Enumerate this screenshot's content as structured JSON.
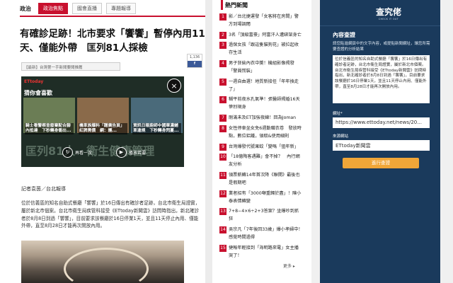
{
  "nav": {
    "category": "政治",
    "tabs": [
      "政治焦點",
      "國會直播",
      "專題報導"
    ]
  },
  "article": {
    "headline": "有確診足跡！北市要求「饗饗」暫停內用11天、僅能外帶　匡列81人採檢",
    "tag": "【最新】台灣第一手新聞要聞推薦",
    "share_count": "1,136",
    "reporter": "記者袁茵／台北報導",
    "body": "位於信義區的知名自助式餐廳「饗饗」於16日傳出有確診者足跡，台北市衛生局證實，屬於新北市個案。台北市衛生局疾管科接受《ETtoday新聞雲》訪問時指出，新北確診者於8月8日到過「饗饗」，目前要求該餐廳於16日停業1天，並且11天停止內用、僅能外帶，直至8月28日才能再次開放內用。"
  },
  "video": {
    "logo": "ETtoday",
    "recommend_label": "猜你會喜歡",
    "bg_text": "匡列81人　衛生健康管理",
    "thumbs": [
      {
        "caption": "騎士看警察查廢棄配合腳內抵達　下秒轉身衝出...",
        "color": "#6b7d55"
      },
      {
        "caption": "機車族爆料「蹭廣告頁」紅牌黑價　網：護...",
        "color": "#8a6a4a"
      },
      {
        "caption": "資訊日報廚師中國華濃鋪車違規　下秒轉身閃蔓...",
        "color": "#4a6a7a"
      }
    ],
    "replay_label": "再看一次",
    "next_label": "播放若要",
    "close_label": "×"
  },
  "hot": {
    "title": "熱門新聞",
    "items": [
      "影／台北捷運發「女客將在房間」警方到場調閱",
      "3名「頂級富豪」阿富汗人遭綁架身亡",
      "過保女孩「跟這隻貓狗花」被拉起收存生活",
      "男子狂偷內衣中獎！機組影像揭發「警員慌裝」",
      "一週自由選！地質新接任「年年換走了」",
      "糊平前夜水孔氣準！張醫師揭婚16天慘烈現身",
      "剛滿未及ET加強夜練！回為Joman",
      "女性停車坐女免6週勤職衣卷　發放時點，數位鋁鐵，領取&使用細則",
      "台灣爆發代號果蚊「變嗎「狙年新」",
      "「18億陶客遇難」會不掉？　內行網友分析",
      "領票薪轉14年首次降《聯開》最後也是假期吧",
      "業者招有「3000噸重歸於盡」！陳小泰表情轉變",
      "7+8−4×6÷2+3答案？坐爆吵到抓狂",
      "吳宗凡「7年後回33歲」爆小孝婦中！感覺時間過得",
      "捷報年輕接到「海明路來電」女主播哭了！"
    ],
    "more_label": "更多"
  },
  "panel": {
    "brand_name": "查究佬",
    "brand_sub": "CHECK IT OUT",
    "title": "內容查證",
    "desc": "請您貼進網頁中的文字內容，或提貼新聞網址，讓您所需要查證的分析結果",
    "textarea_value": "位於信義區的知名自助式餐廳「饗饗」於16日傳出有確診者足跡，台北市衛生局證實，屬於新北市個案。台北市衛生局疾管科接受《ETtoday新聞雲》訪問時指出，新北確診者於8月8日到過「饗饗」，目前要求該餐廳於16日停業1天，並且11天停止內用、僅能外帶，直至8月28日才能再次開放內用。",
    "url_label": "網址*",
    "url_value": "https://www.ettoday.net/news/20...",
    "source_label": "來源網站",
    "source_value": "ETtoday新聞雲",
    "submit_label": "進行查證"
  }
}
